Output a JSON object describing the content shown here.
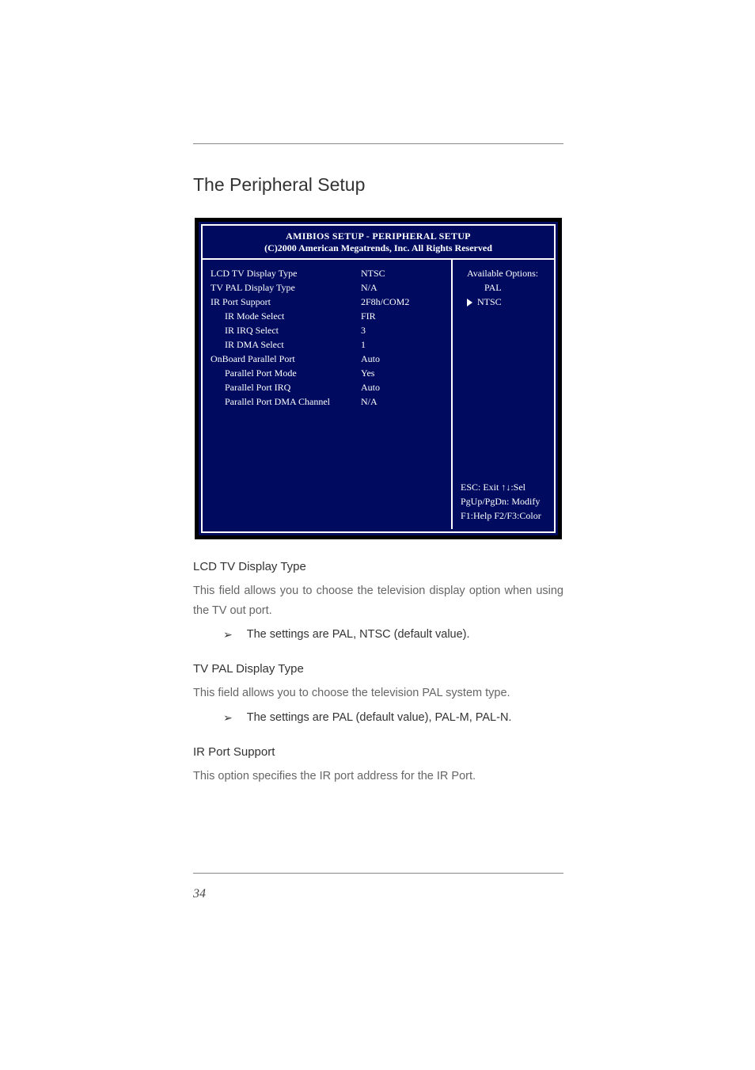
{
  "section_title": "The Peripheral Setup",
  "bios": {
    "title_line1": "AMIBIOS SETUP - PERIPHERAL SETUP",
    "title_line2": "(C)2000 American Megatrends, Inc.  All Rights Reserved",
    "rows": [
      {
        "label": "LCD TV Display Type",
        "value": "NTSC",
        "indent": false
      },
      {
        "label": "TV PAL Display Type",
        "value": "N/A",
        "indent": false
      },
      {
        "label": "IR Port Support",
        "value": "2F8h/COM2",
        "indent": false
      },
      {
        "label": "IR Mode Select",
        "value": "FIR",
        "indent": true
      },
      {
        "label": "IR IRQ Select",
        "value": "3",
        "indent": true
      },
      {
        "label": "IR DMA Select",
        "value": "1",
        "indent": true
      },
      {
        "label": "OnBoard Parallel Port",
        "value": "Auto",
        "indent": false
      },
      {
        "label": "Parallel Port Mode",
        "value": "Yes",
        "indent": true
      },
      {
        "label": "Parallel Port IRQ",
        "value": "Auto",
        "indent": true
      },
      {
        "label": "Parallel Port DMA Channel",
        "value": "N/A",
        "indent": true
      }
    ],
    "options_title": "Available Options:",
    "options": [
      {
        "label": "PAL",
        "selected": false
      },
      {
        "label": "NTSC",
        "selected": true
      }
    ],
    "hints": {
      "line1a": "ESC: Exit ",
      "line1b": ":Sel",
      "line2": "PgUp/PgDn: Modify",
      "line3": "F1:Help  F2/F3:Color"
    }
  },
  "sections": [
    {
      "heading": "LCD TV Display Type",
      "body": "This field allows you to choose the television display option when using the TV out port.",
      "bullet": "The settings are PAL, NTSC (default value)."
    },
    {
      "heading": "TV PAL Display Type",
      "body": "This field allows you to choose the television PAL system type.",
      "bullet": "The settings are PAL (default value), PAL-M, PAL-N."
    },
    {
      "heading": "IR Port Support",
      "body": "This option specifies the IR port address for the IR Port.",
      "bullet": ""
    }
  ],
  "page_number": "34"
}
